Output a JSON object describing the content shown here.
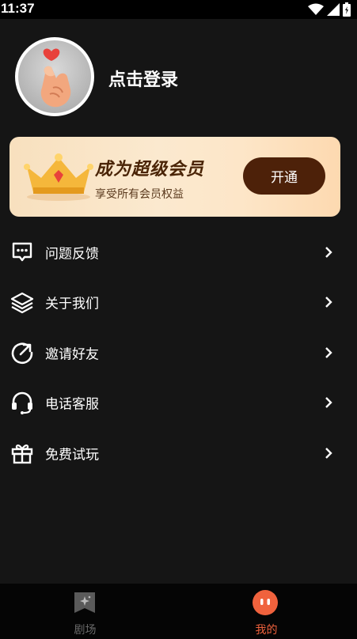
{
  "status_bar": {
    "time": "11:37"
  },
  "profile": {
    "login_text": "点击登录"
  },
  "vip": {
    "title": "成为超级会员",
    "subtitle": "享受所有会员权益",
    "button_label": "开通"
  },
  "menu": {
    "items": [
      {
        "label": "问题反馈",
        "icon": "feedback-icon"
      },
      {
        "label": "关于我们",
        "icon": "layers-icon"
      },
      {
        "label": "邀请好友",
        "icon": "share-icon"
      },
      {
        "label": "电话客服",
        "icon": "headset-icon"
      },
      {
        "label": "免费试玩",
        "icon": "gift-icon"
      }
    ]
  },
  "tabs": [
    {
      "label": "剧场",
      "icon": "theater-icon",
      "active": false
    },
    {
      "label": "我的",
      "icon": "profile-face-icon",
      "active": true
    }
  ],
  "colors": {
    "background": "#151515",
    "accent": "#f0623d",
    "vip_button": "#4d2109",
    "tab_inactive": "#6a6a6a"
  }
}
